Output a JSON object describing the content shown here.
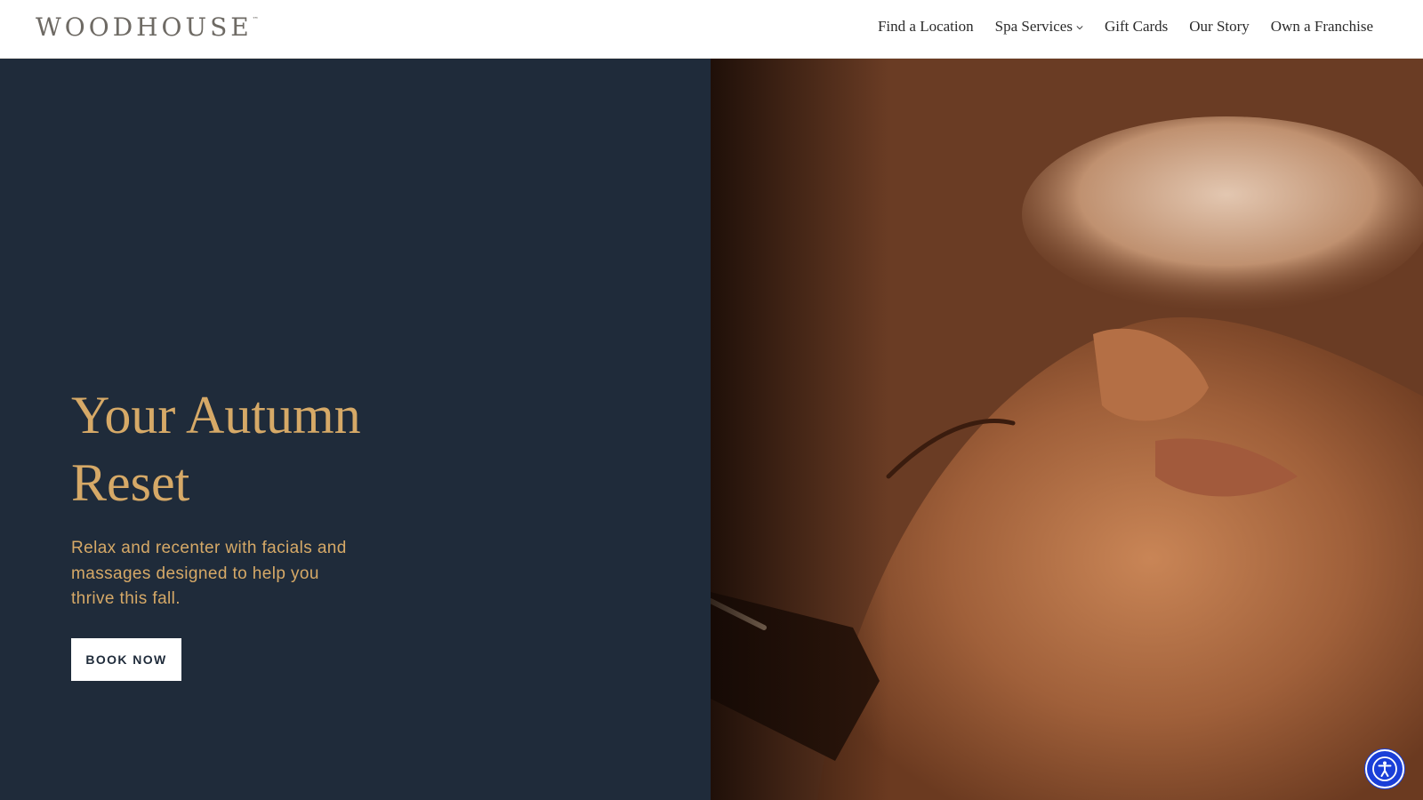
{
  "header": {
    "logo_text": "WOODHOUSE",
    "logo_tm": "™",
    "nav": [
      {
        "label": "Find a Location"
      },
      {
        "label": "Spa Services"
      },
      {
        "label": "Gift Cards"
      },
      {
        "label": "Our Story"
      },
      {
        "label": "Own a Franchise"
      }
    ]
  },
  "hero": {
    "title_line1": "Your Autumn",
    "title_line2": "Reset",
    "subtitle": "Relax and recenter with facials and massages designed to help you thrive this fall.",
    "cta_label": "BOOK NOW"
  },
  "colors": {
    "panel_bg": "#1f2b3a",
    "accent_gold": "#d6a967",
    "a11y_blue": "#1a3fd8"
  },
  "icons": {
    "dropdown": "chevron-down-icon",
    "accessibility": "accessibility-icon"
  }
}
